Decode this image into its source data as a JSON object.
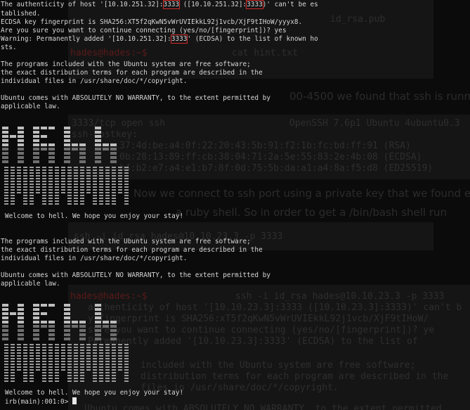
{
  "terminal": {
    "ssh_host_check": {
      "part1": "The authenticity of host '[10.10.251.32]:",
      "port1": "3333",
      "part2": " ([10.10.251.32]:",
      "port2": "3333",
      "part3": ")' can't be es",
      "line2": "tablished.",
      "fingerprint": "ECDSA key fingerprint is SHA256:XT5f2qKwN5vWrUVIEkkL92j1vcb/XjF9tIHoW/yyyx8.",
      "confirm": "Are you sure you want to continue connecting (yes/no/[fingerprint])? yes",
      "warn_part1": "Warning: Permanently added '[10.10.251.32]:",
      "warn_port": "3333",
      "warn_part2": "' (ECDSA) to the list of known ho",
      "warn_line2": "sts."
    },
    "motd": [
      "The programs included with the Ubuntu system are free software;",
      "the exact distribution terms for each program are described in the",
      "individual files in /usr/share/doc/*/copyright.",
      "",
      "Ubuntu comes with ABSOLUTELY NO WARRANTY, to the extent permitted by",
      "applicable law."
    ],
    "welcome": "Welcome to hell. We hope you enjoy your stay!",
    "prompt": "irb(main):001:0> "
  },
  "background": {
    "filename": "id_rsa.pub",
    "cat_cmd": "cat hint.txt",
    "port_text": "00-4500 we found that ssh is runn",
    "nmap_row": "3333/tcp  open  ssh",
    "nmap_ver": "OpenSSH 7.6p1 Ubuntu 4ubuntu0.3",
    "hostkey": "ssh-hostkey:",
    "rsa": "37:4d:be:a4:0f:22:20:43:5b:91:f2:1b:fc:bd:ff:91 (RSA)",
    "ecdsa": "0b:28:13:89:ff:cb:38:04:71:2a:5e:55:83:2e:4b:08 (ECDSA)",
    "ed": "b4:b2:e7:a4:e1:b7:8f:0d:75:5b:da:a1:a4:8a:f5:d8 (ED25519)",
    "prose1": "Now we connect to ssh port using a private key that we found earlier. Now we",
    "prose2": "a ruby shell. So in order to get a /bin/bash shell run",
    "cmd": "ssh -i id_rsa hades@10.10.23.3 -p 3333",
    "ssh_cmd2": "ssh -i id_rsa hades@10.10.23.3 -p 3333",
    "auth": "authenticity of host '[10.10.23.3]:3333 ([10.10.23.3]:3333)' can't b",
    "fp": "y fingerprint is SHA256:xT5f2qKwN5vWrUVIEkkL92j1vcb/XjF9tIHoW/",
    "sure": "sure you want to continue connecting (yes/no/[fingerprint])? ye",
    "added": "Permanently added '[10.10.23.3]:3333' (ECDSA) to the list of",
    "included": "included with the Ubuntu system are free software;",
    "distrib": "distribution terms for each program are described in the",
    "files": "files in /usr/share/doc/*/copyright.",
    "bottom": "Ubuntu comes with ABSOLUTELY NO WARRANTY, to the extent permitted"
  },
  "colors": {
    "highlight_box": "#d42a2a",
    "terminal_text": "#d8d8d8",
    "background": "#0b0b0b"
  }
}
